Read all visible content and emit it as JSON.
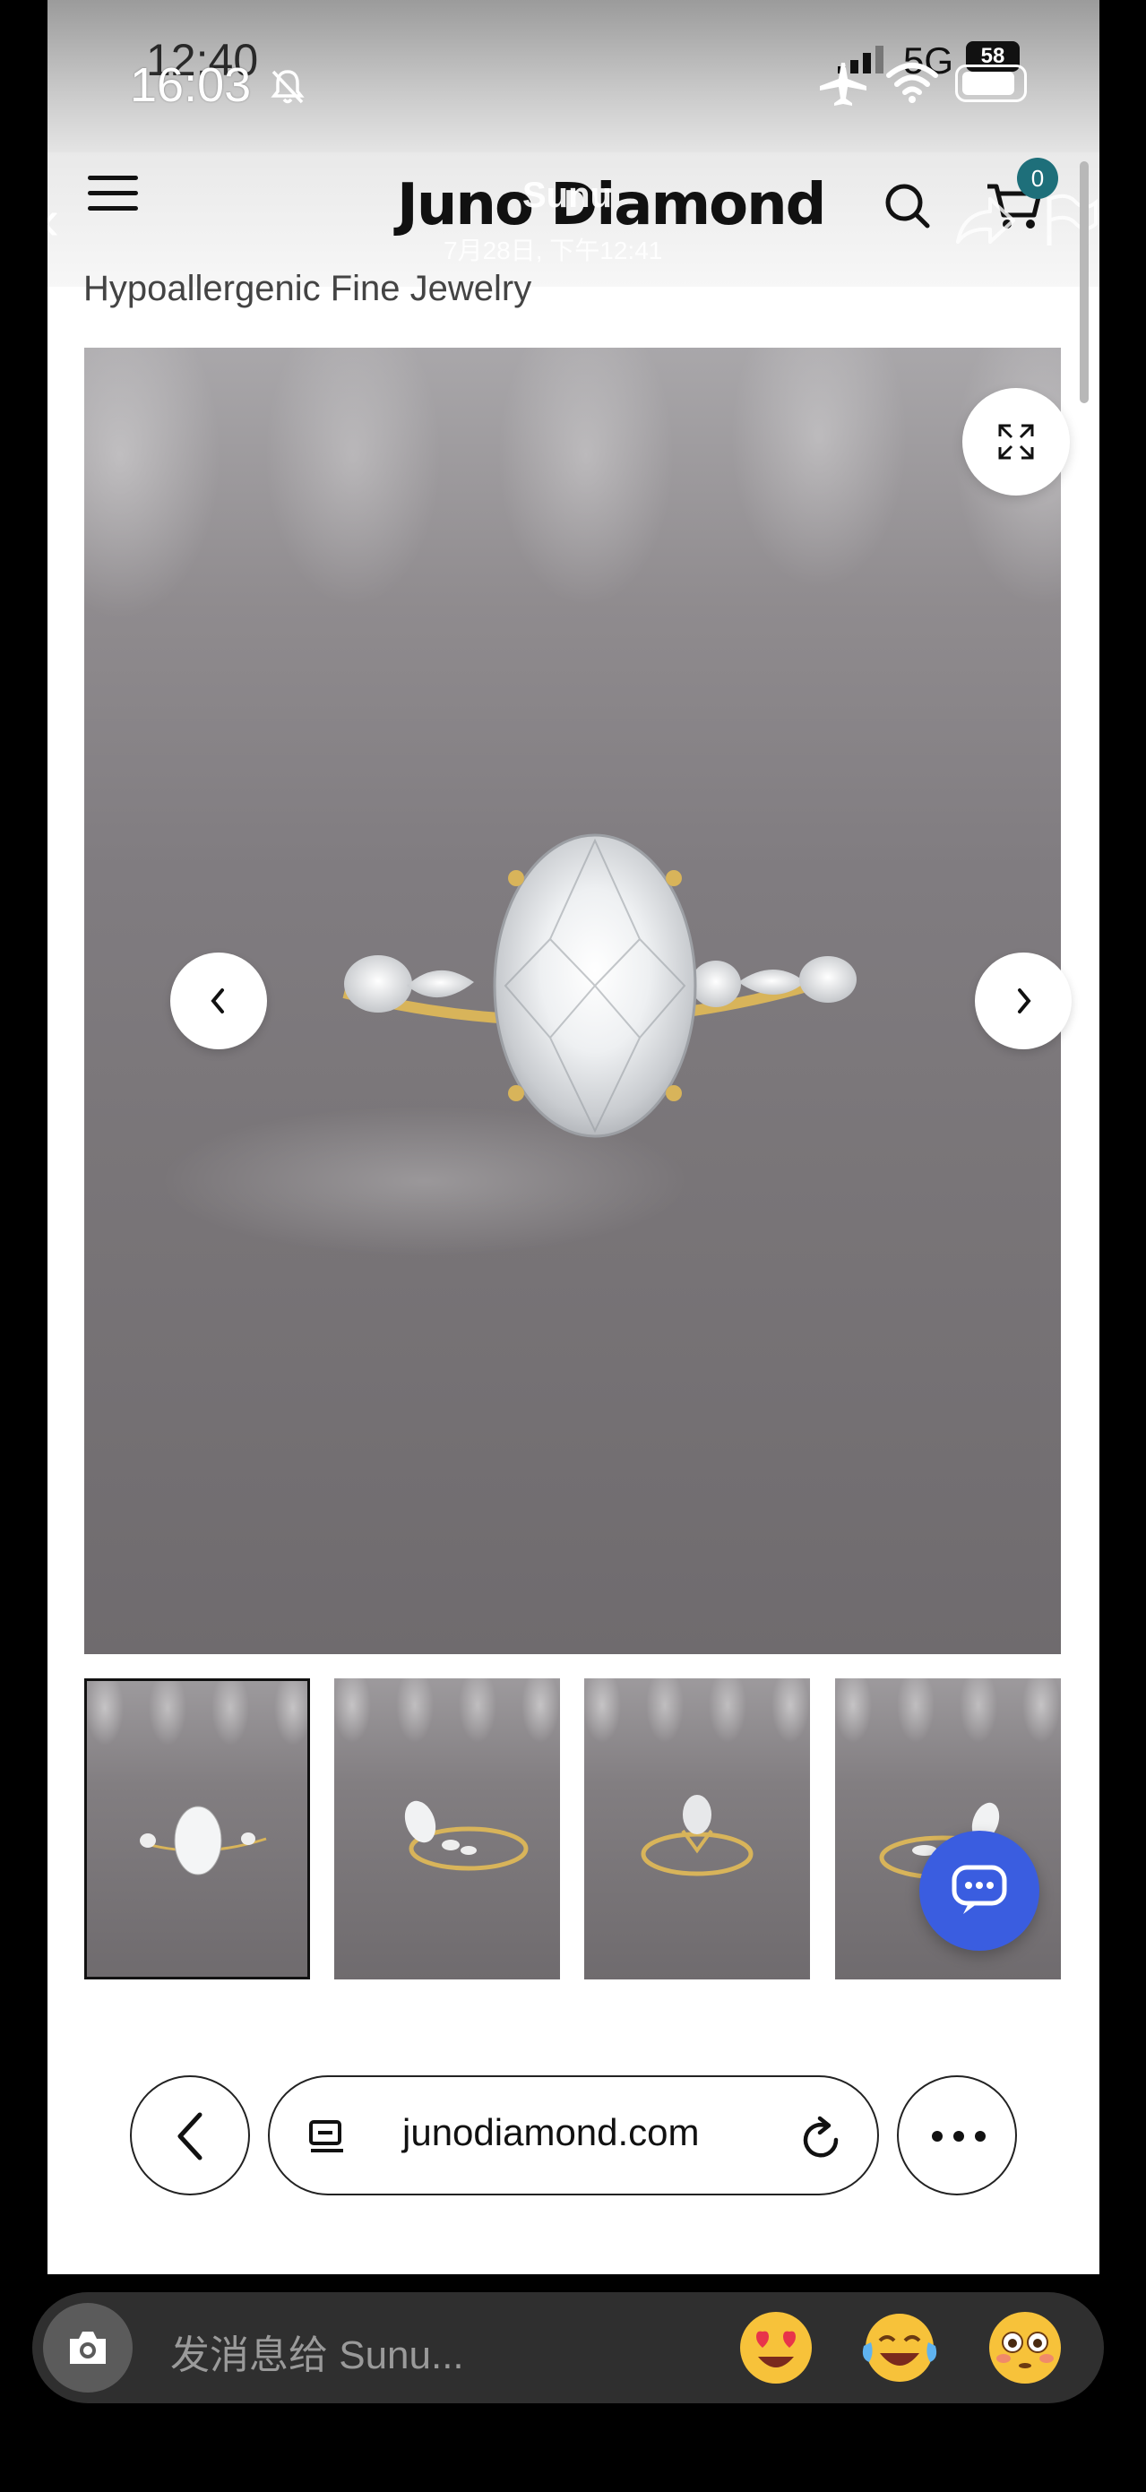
{
  "status_bar": {
    "time_back": "12:40",
    "time_front": "16:03",
    "network": "5G",
    "battery_back": "58"
  },
  "header": {
    "brand": "Juno Diamond",
    "cart_count": "0",
    "chat_name": "Sunu",
    "chat_timestamp": "7月28日, 下午12:41"
  },
  "tagline": "Hypoallergenic Fine Jewelry",
  "browser": {
    "address": "junodiamond.com"
  },
  "message_bar": {
    "placeholder": "发消息给 Sunu...",
    "emojis": [
      "😍",
      "😂",
      "😳"
    ]
  },
  "colors": {
    "cart_badge": "#1e6f7a",
    "chat_widget": "#3a5de0"
  }
}
